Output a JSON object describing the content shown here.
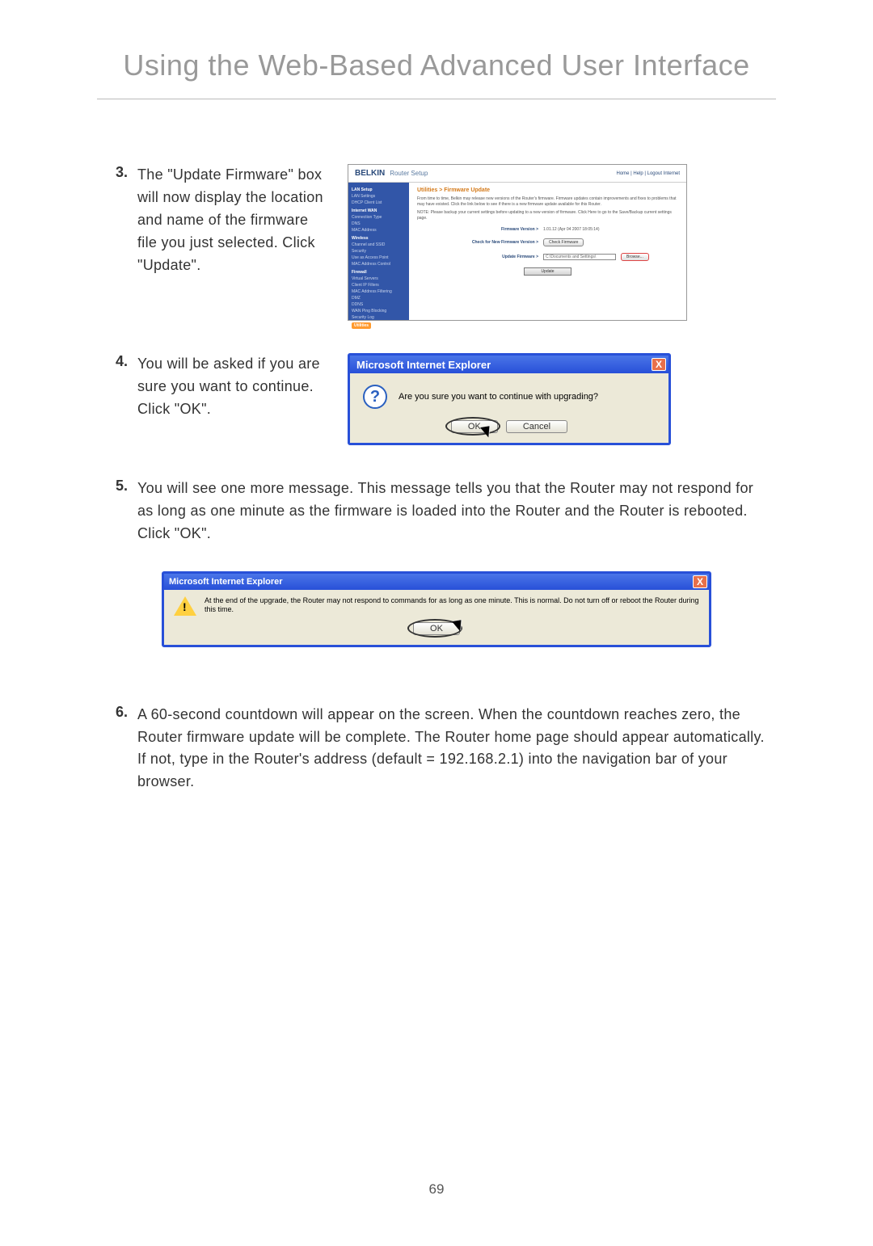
{
  "page_title": "Using the Web-Based Advanced User Interface",
  "page_number": "69",
  "steps": {
    "s3": {
      "num": "3.",
      "text": "The \"Update Firmware\" box will now display the location and name of the firmware file you just selected. Click \"Update\"."
    },
    "s4": {
      "num": "4.",
      "text": "You will be asked if you are sure you want to continue. Click \"OK\"."
    },
    "s5": {
      "num": "5.",
      "text": "You will see one more message. This message tells you that the Router may not respond for as long as one minute as the firmware is loaded into the Router and the Router is rebooted. Click \"OK\"."
    },
    "s6": {
      "num": "6.",
      "text": "A 60-second countdown will appear on the screen. When the countdown reaches zero, the Router firmware update will be complete. The Router home page should appear automatically. If not, type in the Router's address (default = 192.168.2.1) into the navigation bar of your browser."
    }
  },
  "router": {
    "brand": "BELKIN",
    "header_sub": "Router Setup",
    "top_links": "Home | Help | Logout   Internet",
    "breadcrumb": "Utilities > Firmware Update",
    "desc": "From time to time, Belkin may release new versions of the Router's firmware. Firmware updates contain improvements and fixes to problems that may have existed. Click the link below to see if there is a new firmware update available for this Router.",
    "note": "NOTE: Please backup your current settings before updating to a new version of firmware. Click Here to go to the Save/Backup current settings page.",
    "nav": {
      "hdr1": "LAN Setup",
      "i1": "LAN Settings",
      "i2": "DHCP Client List",
      "hdr2": "Internet WAN",
      "i3": "Connection Type",
      "i4": "DNS",
      "i5": "MAC Address",
      "hdr3": "Wireless",
      "i6": "Channel and SSID",
      "i7": "Security",
      "i8": "Use as Access Point",
      "i9": "MAC Address Control",
      "hdr4": "Firewall",
      "i10": "Virtual Servers",
      "i11": "Client IP Filters",
      "i12": "MAC Address Filtering",
      "i13": "DMZ",
      "i14": "DDNS",
      "i15": "WAN Ping Blocking",
      "i16": "Security Log",
      "hdr5": "Utilities"
    },
    "row1_label": "Firmware Version >",
    "row1_value": "1.01.12 (Apr 04 2007 18:05:14)",
    "row2_label": "Check for New Firmware Version >",
    "row2_button": "Check Firmware",
    "row3_label": "Update Firmware >",
    "row3_value": "C:\\Documents and Settings\\",
    "row3_button": "Browse...",
    "update_button": "Update"
  },
  "dialog1": {
    "title": "Microsoft Internet Explorer",
    "message": "Are you sure you want to continue with upgrading?",
    "ok": "OK",
    "cancel": "Cancel",
    "close": "X"
  },
  "dialog2": {
    "title": "Microsoft Internet Explorer",
    "message": "At the end of the upgrade, the Router may not respond to commands for as long as one minute. This is normal. Do not turn off or reboot the Router during this time.",
    "ok": "OK",
    "close": "X"
  }
}
